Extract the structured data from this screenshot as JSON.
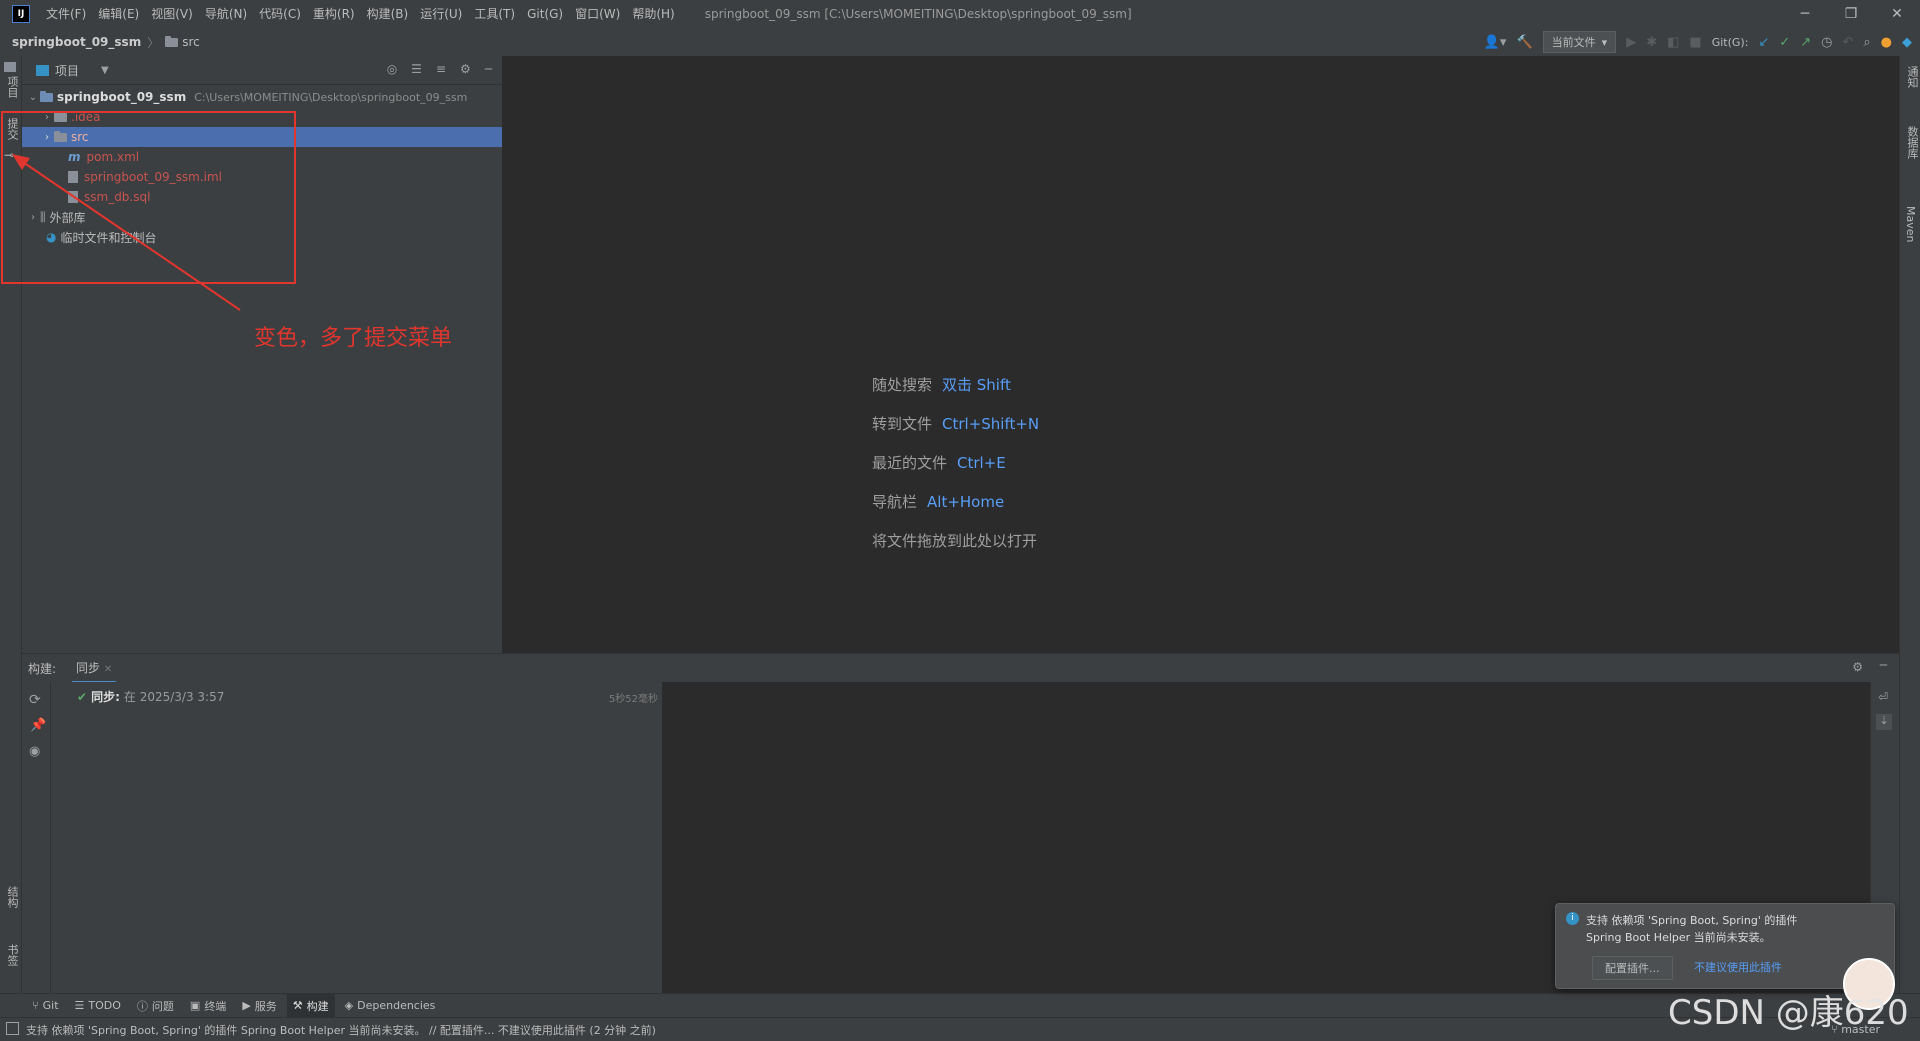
{
  "menu": {
    "items": [
      "文件(F)",
      "编辑(E)",
      "视图(V)",
      "导航(N)",
      "代码(C)",
      "重构(R)",
      "构建(B)",
      "运行(U)",
      "工具(T)",
      "Git(G)",
      "窗口(W)",
      "帮助(H)"
    ],
    "window_title": "springboot_09_ssm [C:\\Users\\MOMEITING\\Desktop\\springboot_09_ssm]",
    "logo": "IJ"
  },
  "navbar": {
    "project": "springboot_09_ssm",
    "sep": "〉",
    "folder": "src",
    "current_file": "当前文件",
    "git_label": "Git(G):"
  },
  "left_stripe": {
    "project": "项目",
    "commit": "提交",
    "structure": "结构",
    "bookmarks": "书签"
  },
  "right_stripe": {
    "notifications": "通知",
    "db": "数据库",
    "maven": "Maven"
  },
  "project_panel": {
    "title": "项目",
    "root_name": "springboot_09_ssm",
    "root_path": "C:\\Users\\MOMEITING\\Desktop\\springboot_09_ssm",
    "idea": ".idea",
    "src": "src",
    "pom": "pom.xml",
    "iml": "springboot_09_ssm.iml",
    "sql": "ssm_db.sql",
    "external": "外部库",
    "scratches": "临时文件和控制台"
  },
  "editor": {
    "hints": [
      {
        "label": "随处搜索",
        "key": "双击 Shift"
      },
      {
        "label": "转到文件",
        "key": "Ctrl+Shift+N"
      },
      {
        "label": "最近的文件",
        "key": "Ctrl+E"
      },
      {
        "label": "导航栏",
        "key": "Alt+Home"
      }
    ],
    "drop": "将文件拖放到此处以打开"
  },
  "build": {
    "label": "构建:",
    "tab": "同步",
    "sync_label": "同步:",
    "sync_time": "在 2025/3/3 3:57",
    "duration": "5秒52毫秒"
  },
  "tooltabs": [
    "Git",
    "TODO",
    "问题",
    "终端",
    "服务",
    "构建",
    "Dependencies"
  ],
  "status": {
    "text": "支持 依赖项 'Spring Boot, Spring' 的插件 Spring Boot Helper 当前尚未安装。 // 配置插件...   不建议使用此插件 (2 分钟 之前)",
    "branch": "master"
  },
  "notification": {
    "line1": "支持 依赖项 'Spring Boot, Spring' 的插件",
    "line2": "Spring Boot Helper 当前尚未安装。",
    "button": "配置插件...",
    "link": "不建议使用此插件"
  },
  "annotation": {
    "text": "变色，多了提交菜单"
  },
  "watermark": "CSDN @康620",
  "colors": {
    "accent": "#589df6",
    "selection": "#4b6eaf",
    "annotation": "#e0362e",
    "unversioned": "#c75450"
  }
}
